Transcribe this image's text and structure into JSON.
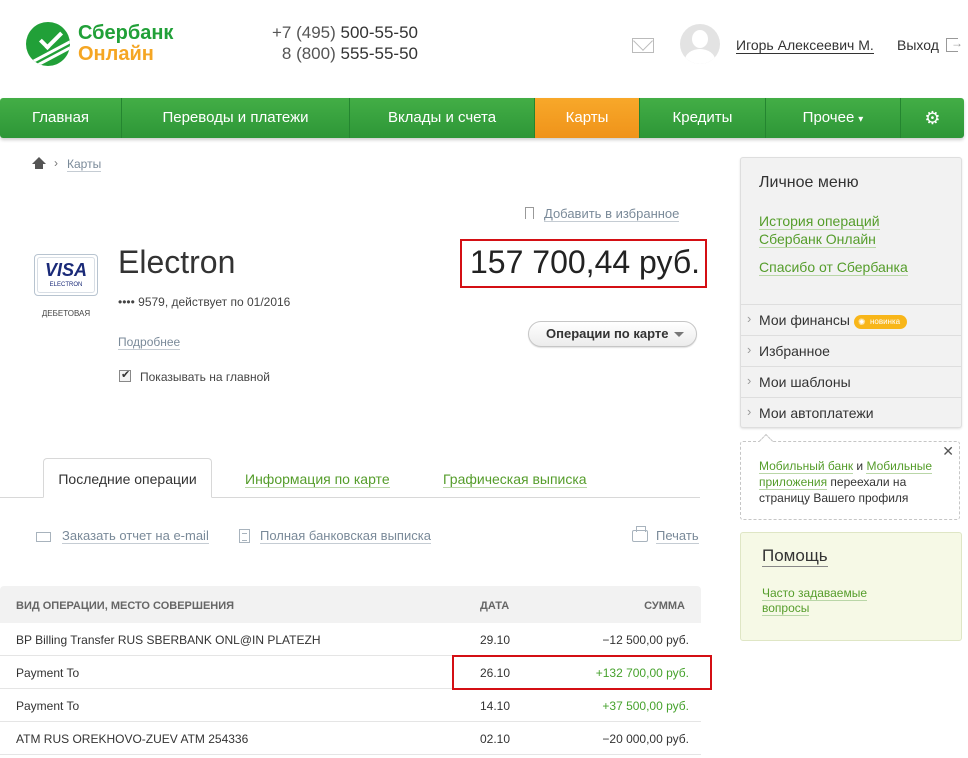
{
  "brand": {
    "line1": "Сбербанк",
    "line2": "Онлайн",
    "primary_color": "#21a038",
    "accent_color": "#f5a623"
  },
  "header": {
    "phone1_prefix": "+7 (495) ",
    "phone1_number": "500-55-50",
    "phone2_prefix": "8 (800) ",
    "phone2_number": "555-55-50",
    "user_name": "Игорь Алексеевич М.",
    "logout": "Выход"
  },
  "nav": {
    "items": [
      {
        "label": "Главная"
      },
      {
        "label": "Переводы и платежи"
      },
      {
        "label": "Вклады и счета"
      },
      {
        "label": "Карты"
      },
      {
        "label": "Кредиты"
      },
      {
        "label": "Прочее"
      }
    ],
    "active": "Карты",
    "active_color": "#f39c1e",
    "caret": "▾",
    "gear": "⚙"
  },
  "breadcrumb": {
    "current": "Карты"
  },
  "favorite": {
    "label": "Добавить в избранное"
  },
  "card": {
    "brand": "VISA",
    "brand_sub": "ELECTRON",
    "type": "ДЕБЕТОВАЯ",
    "name": "Electron",
    "number_info": "•••• 9579, действует по 01/2016",
    "more": "Подробнее",
    "show_on_main": "Показывать на главной",
    "balance": "157 700,44 руб.",
    "operations_button": "Операции по карте"
  },
  "tabs": {
    "active": "Последние операции",
    "info": "Информация по карте",
    "graph": "Графическая выписка"
  },
  "actions": {
    "email": "Заказать отчет на e-mail",
    "statement": "Полная банковская выписка",
    "print": "Печать"
  },
  "table": {
    "headers": {
      "name": "ВИД ОПЕРАЦИИ, МЕСТО СОВЕРШЕНИЯ",
      "date": "ДАТА",
      "sum": "СУММА"
    },
    "rows": [
      {
        "name": "BP Billing Transfer RUS SBERBANK ONL@IN PLATEZH",
        "date": "29.10",
        "sum": "−12 500,00 руб."
      },
      {
        "name": "Payment To",
        "date": "26.10",
        "sum": "+132 700,00 руб."
      },
      {
        "name": "Payment To",
        "date": "14.10",
        "sum": "+37 500,00 руб."
      },
      {
        "name": "ATM RUS OREKHOVO-ZUEV ATM 254336",
        "date": "02.10",
        "sum": "−20 000,00 руб."
      }
    ],
    "positive_color": "#46a22d"
  },
  "sidebar": {
    "title": "Личное меню",
    "history_link": "История операций Сбербанк Онлайн",
    "thanks_link": "Спасибо от Сбербанка",
    "items": [
      {
        "label": "Мои финансы",
        "badge": "новинка"
      },
      {
        "label": "Избранное"
      },
      {
        "label": "Мои шаблоны"
      },
      {
        "label": "Мои автоплатежи"
      }
    ]
  },
  "mobile_notice": {
    "link1": "Мобильный банк",
    "and": " и ",
    "link2": "Мобильные приложения",
    "text": " переехали на страницу Вашего профиля",
    "close": "✕"
  },
  "help": {
    "title": "Помощь",
    "faq_link": "Часто задаваемые вопросы"
  }
}
